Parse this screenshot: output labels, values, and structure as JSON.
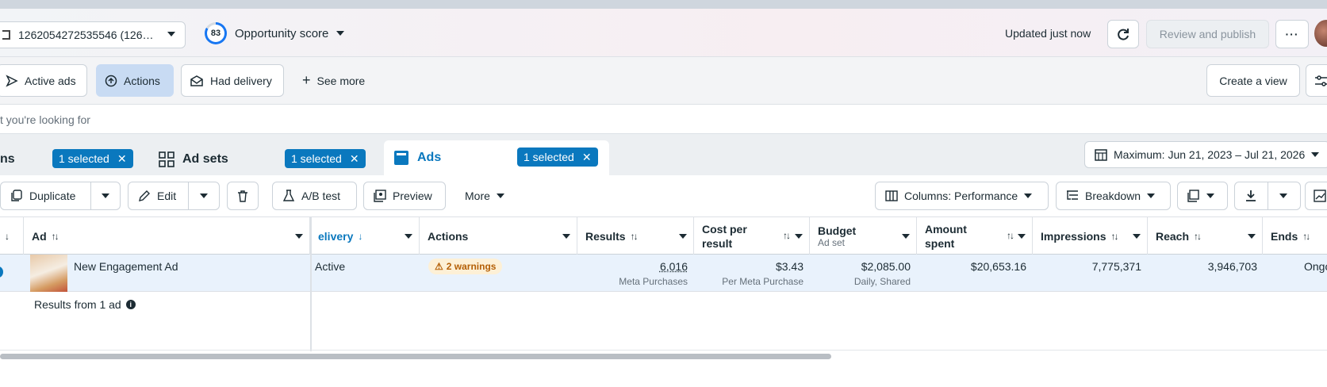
{
  "topbar": {
    "account_label": "1262054272535546 (126…",
    "opportunity_score": "83",
    "opportunity_label": "Opportunity score",
    "updated_text": "Updated just now",
    "review_publish": "Review and publish"
  },
  "filters": {
    "active_ads": "Active ads",
    "actions": "Actions",
    "had_delivery": "Had delivery",
    "see_more": "See more",
    "create_view": "Create a view"
  },
  "search": {
    "placeholder": "t you're looking for"
  },
  "tabs": {
    "campaigns": "ns",
    "campaigns_badge": "1 selected",
    "adsets": "Ad sets",
    "adsets_badge": "1 selected",
    "ads": "Ads",
    "ads_badge": "1 selected",
    "date_range": "Maximum: Jun 21, 2023 – Jul 21, 2026"
  },
  "toolbar": {
    "duplicate": "Duplicate",
    "edit": "Edit",
    "ab_test": "A/B test",
    "preview": "Preview",
    "more": "More",
    "columns": "Columns: Performance",
    "breakdown": "Breakdown"
  },
  "columns": {
    "ad": "Ad",
    "delivery": "elivery",
    "actions": "Actions",
    "results": "Results",
    "cost_per_result": "Cost per result",
    "budget": "Budget",
    "budget_sub": "Ad set",
    "amount_spent": "Amount spent",
    "impressions": "Impressions",
    "reach": "Reach",
    "ends": "Ends"
  },
  "row": {
    "ad_name": "New Engagement Ad",
    "delivery": "Active",
    "warnings": "2 warnings",
    "results": "6,016",
    "results_sub": "Meta Purchases",
    "cost": "$3.43",
    "cost_sub": "Per Meta Purchase",
    "budget": "$2,085.00",
    "budget_sub": "Daily, Shared",
    "amount_spent": "$20,653.16",
    "impressions": "7,775,371",
    "reach": "3,946,703",
    "ends": "Ongo"
  },
  "footer": {
    "results_from": "Results from 1 ad"
  }
}
